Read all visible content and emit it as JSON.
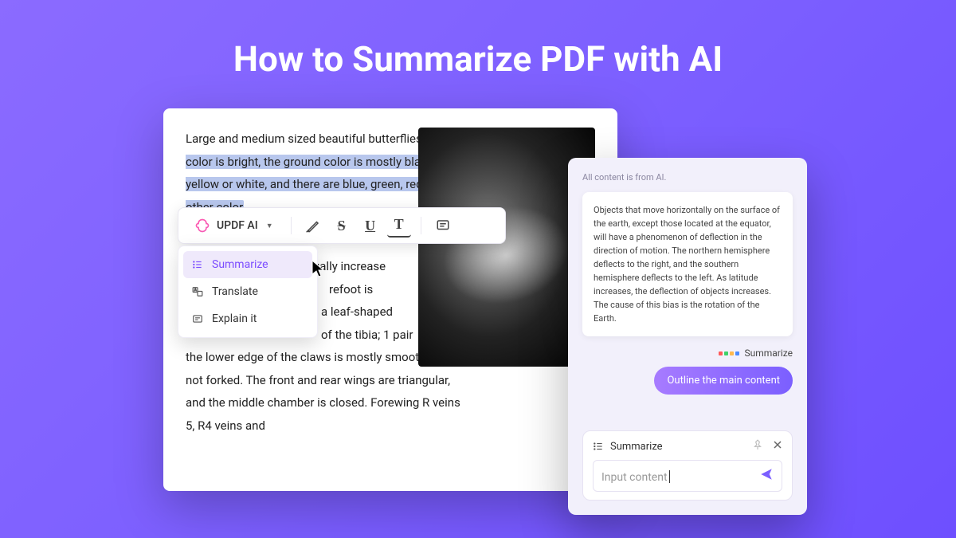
{
  "title": "How to Summarize PDF with AI",
  "pdf": {
    "text_before": "Large and medium sized beautiful butterflies. ",
    "highlighted": "The color is bright, the ground color is mostly black, yellow or white, and there are blue, green, red and other color",
    "frag1": "ually increase",
    "frag2": "refoot is",
    "frag3": " a leaf-shaped",
    "frag4": " of the tibia; 1 pair",
    "frag5": " the lower edge of the claws is mostly smooth and not forked. The front and rear wings are triangular, and the middle chamber is closed. Forewing R veins 5, R4 veins and"
  },
  "toolbar": {
    "ai_label": "UPDF AI",
    "items": {
      "highlight": "highlighter",
      "strike": "strikethrough",
      "underline": "underline",
      "text": "text",
      "comment": "comment"
    }
  },
  "dropdown": {
    "summarize": "Summarize",
    "translate": "Translate",
    "explain": "Explain it"
  },
  "ai_panel": {
    "note": "All content is from AI.",
    "response": "Objects that move horizontally on the surface of the earth, except those located at the equator, will have a phenomenon of deflection in the direction of motion. The northern hemisphere deflects to the right, and the southern hemisphere deflects to the left. As latitude increases, the deflection of objects increases. The cause of this bias is the rotation of the Earth.",
    "tag": "Summarize",
    "user_msg": "Outline the main content",
    "input_mode": "Summarize",
    "placeholder": "Input content"
  }
}
